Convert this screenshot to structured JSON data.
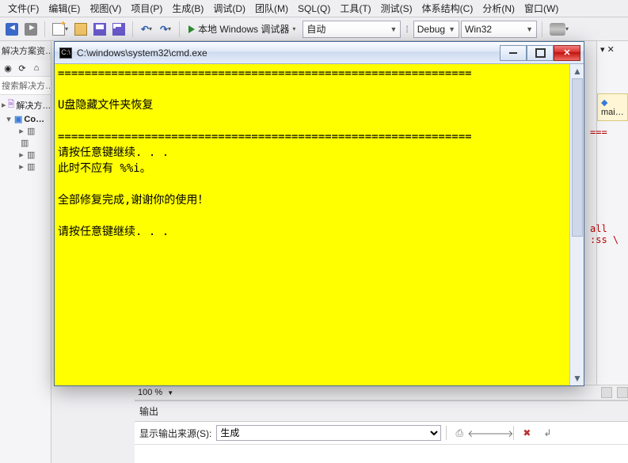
{
  "menu": {
    "items": [
      "文件(F)",
      "编辑(E)",
      "视图(V)",
      "项目(P)",
      "生成(B)",
      "调试(D)",
      "团队(M)",
      "SQL(Q)",
      "工具(T)",
      "测试(S)",
      "体系结构(C)",
      "分析(N)",
      "窗口(W)"
    ]
  },
  "toolbar": {
    "debug_target": "本地 Windows 调试器",
    "run_mode": "自动",
    "config": "Debug",
    "platform": "Win32"
  },
  "sidebar": {
    "title": "解决方案资…",
    "search_placeholder": "搜索解决方…",
    "solution": "解决方…",
    "project": "Co…",
    "refs": [
      "▣",
      "▣",
      "▣",
      "▣"
    ]
  },
  "right": {
    "doc_tab": "mai…",
    "err1": "===",
    "err2": "all :ss \\"
  },
  "zoom": {
    "pct": "100 %"
  },
  "output": {
    "title": "输出",
    "src_label": "显示输出来源(S):",
    "src_value": "生成"
  },
  "cmd": {
    "path": "C:\\windows\\system32\\cmd.exe",
    "lines": [
      "==============================================================",
      "",
      "U盘隐藏文件夹恢复",
      "",
      "==============================================================",
      "请按任意键继续. . .",
      "此时不应有 %%i。",
      "",
      "全部修复完成,谢谢你的使用！",
      "",
      "请按任意键继续. . ."
    ]
  }
}
